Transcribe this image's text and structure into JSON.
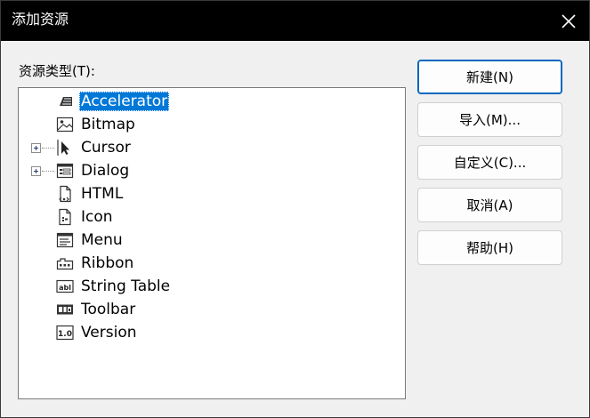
{
  "window": {
    "title": "添加资源"
  },
  "resource_types_label": "资源类型(T):",
  "resource_types": [
    {
      "label": "Accelerator",
      "icon": "accelerator-icon",
      "selected": true,
      "expandable": false
    },
    {
      "label": "Bitmap",
      "icon": "bitmap-icon",
      "selected": false,
      "expandable": false
    },
    {
      "label": "Cursor",
      "icon": "cursor-icon",
      "selected": false,
      "expandable": true
    },
    {
      "label": "Dialog",
      "icon": "dialog-icon",
      "selected": false,
      "expandable": true
    },
    {
      "label": "HTML",
      "icon": "html-icon",
      "selected": false,
      "expandable": false
    },
    {
      "label": "Icon",
      "icon": "icon-resource-icon",
      "selected": false,
      "expandable": false
    },
    {
      "label": "Menu",
      "icon": "menu-icon",
      "selected": false,
      "expandable": false
    },
    {
      "label": "Ribbon",
      "icon": "ribbon-icon",
      "selected": false,
      "expandable": false
    },
    {
      "label": "String Table",
      "icon": "string-table-icon",
      "selected": false,
      "expandable": false
    },
    {
      "label": "Toolbar",
      "icon": "toolbar-icon",
      "selected": false,
      "expandable": false
    },
    {
      "label": "Version",
      "icon": "version-icon",
      "selected": false,
      "expandable": false
    }
  ],
  "buttons": {
    "new": "新建(N)",
    "import": "导入(M)...",
    "custom": "自定义(C)...",
    "cancel": "取消(A)",
    "help": "帮助(H)"
  },
  "colors": {
    "selection": "#0078d7",
    "default_button_border": "#0067c0",
    "titlebar": "#000000"
  }
}
